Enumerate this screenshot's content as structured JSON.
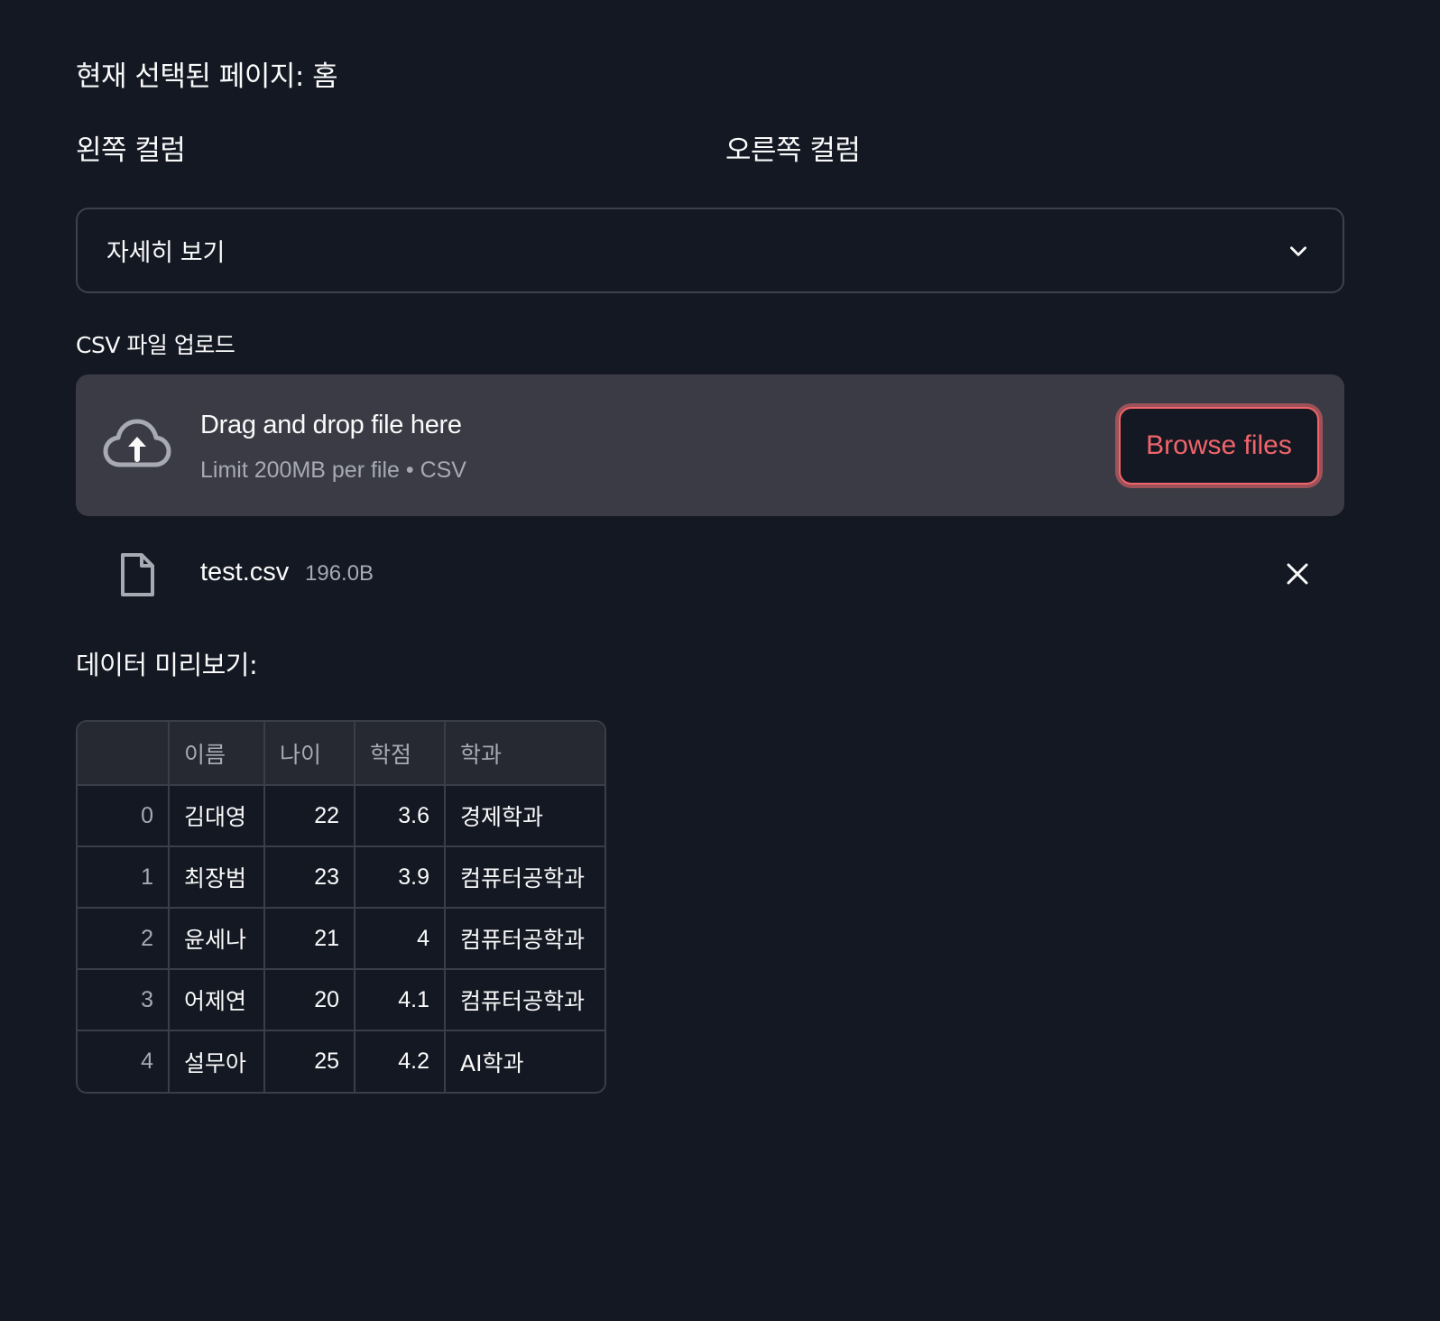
{
  "page": {
    "title": "현재 선택된 페이지: 홈"
  },
  "columns": {
    "left_heading": "왼쪽 컬럼",
    "right_heading": "오른쪽 컬럼"
  },
  "select": {
    "value": "자세히 보기",
    "icon": "chevron-down-icon"
  },
  "uploader": {
    "label": "CSV 파일 업로드",
    "drop_text": "Drag and drop file here",
    "limit_text": "Limit 200MB per file • CSV",
    "browse_label": "Browse files",
    "icon": "cloud-upload-icon",
    "accent_color": "#f0656a"
  },
  "uploaded_file": {
    "name": "test.csv",
    "size": "196.0B",
    "icon": "file-icon",
    "remove_icon": "close-icon"
  },
  "preview": {
    "heading": "데이터 미리보기:",
    "columns": [
      "",
      "이름",
      "나이",
      "학점",
      "학과"
    ],
    "rows": [
      {
        "index": "0",
        "name": "김대영",
        "age": "22",
        "gpa": "3.6",
        "dept": "경제학과"
      },
      {
        "index": "1",
        "name": "최장범",
        "age": "23",
        "gpa": "3.9",
        "dept": "컴퓨터공학과"
      },
      {
        "index": "2",
        "name": "윤세나",
        "age": "21",
        "gpa": "4",
        "dept": "컴퓨터공학과"
      },
      {
        "index": "3",
        "name": "어제연",
        "age": "20",
        "gpa": "4.1",
        "dept": "컴퓨터공학과"
      },
      {
        "index": "4",
        "name": "설무아",
        "age": "25",
        "gpa": "4.2",
        "dept": "AI학과"
      }
    ]
  }
}
